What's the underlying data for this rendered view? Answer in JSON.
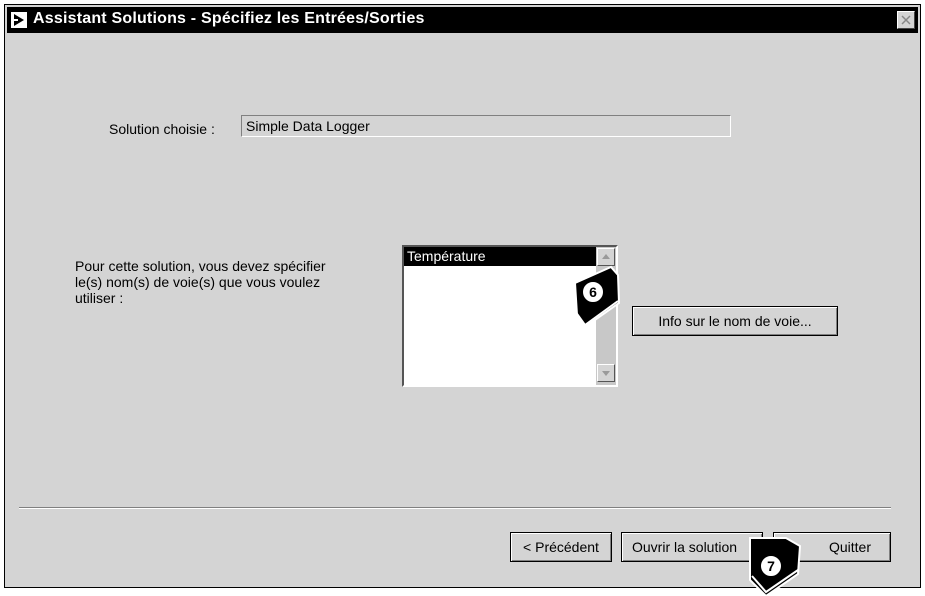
{
  "window": {
    "title": "Assistant Solutions - Spécifiez les Entrées/Sorties",
    "close_label": "×"
  },
  "solution": {
    "label": "Solution choisie :",
    "value": "Simple Data Logger"
  },
  "channels": {
    "description_lines": [
      "Pour cette solution, vous devez spécifier",
      "le(s) nom(s) de voie(s) que vous voulez",
      "utiliser :"
    ],
    "items": [
      "Température"
    ],
    "selected_item": "Température"
  },
  "buttons": {
    "info": "Info sur le nom de voie...",
    "previous": "< Précédent",
    "open": "Ouvrir la solution",
    "quit": "Quitter"
  },
  "callouts": {
    "first": "6",
    "second": "7"
  }
}
